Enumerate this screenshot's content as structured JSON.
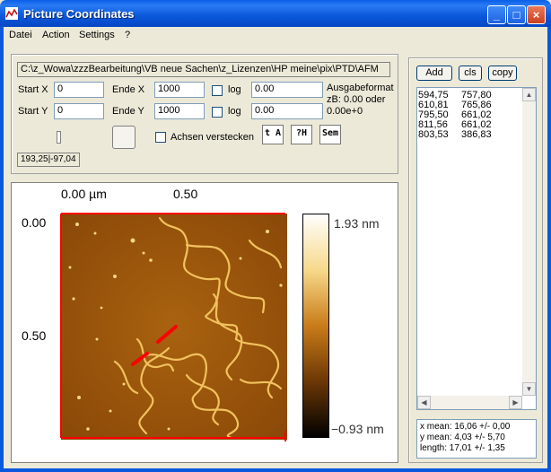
{
  "window": {
    "title": "Picture Coordinates",
    "min": "_",
    "max": "□",
    "close": "×"
  },
  "menu": [
    "Datei",
    "Action",
    "Settings",
    "?"
  ],
  "controls": {
    "path": "C:\\z_Wowa\\zzzBearbeitung\\VB neue Sachen\\z_Lizenzen\\HP meine\\pix\\PTD\\AFM",
    "startx_label": "Start X",
    "startx_value": "0",
    "endex_label": "Ende X",
    "endex_value": "1000",
    "starty_label": "Start Y",
    "starty_value": "0",
    "endey_label": "Ende Y",
    "endey_value": "1000",
    "log_label": "log",
    "logx_value": "0.00",
    "logy_value": "0.00",
    "format_line1": "Ausgabeformat",
    "format_line2": "zB: 0.00 oder",
    "format_line3": "0.00e+0",
    "hide_axes_label": "Achsen verstecken",
    "coord_readout": "193,25|-97,04",
    "icon_axes": "t A",
    "icon_help": "?H",
    "icon_sem": "Sem"
  },
  "right_panel": {
    "add_label": "Add",
    "cls_label": "cls",
    "copy_label": "copy",
    "rows": [
      [
        "594,75",
        "757,80"
      ],
      [
        "610,81",
        "765,86"
      ],
      [
        "795,50",
        "661,02"
      ],
      [
        "811,56",
        "661,02"
      ],
      [
        "803,53",
        "386,83"
      ]
    ],
    "stats": [
      "x mean: 16,06 +/- 0,00",
      "y mean: 4,03 +/- 5,70",
      "length: 17,01 +/- 1,35"
    ]
  },
  "image_panel": {
    "x_tick_1": "0.00 µm",
    "x_tick_2": "0.50",
    "y_tick_1": "0.00",
    "y_tick_2": "0.50",
    "scale_max": "1.93 nm",
    "scale_min": "−0.93 nm"
  },
  "colors": {
    "accent": "#0a58db",
    "marker": "#ff0000"
  }
}
